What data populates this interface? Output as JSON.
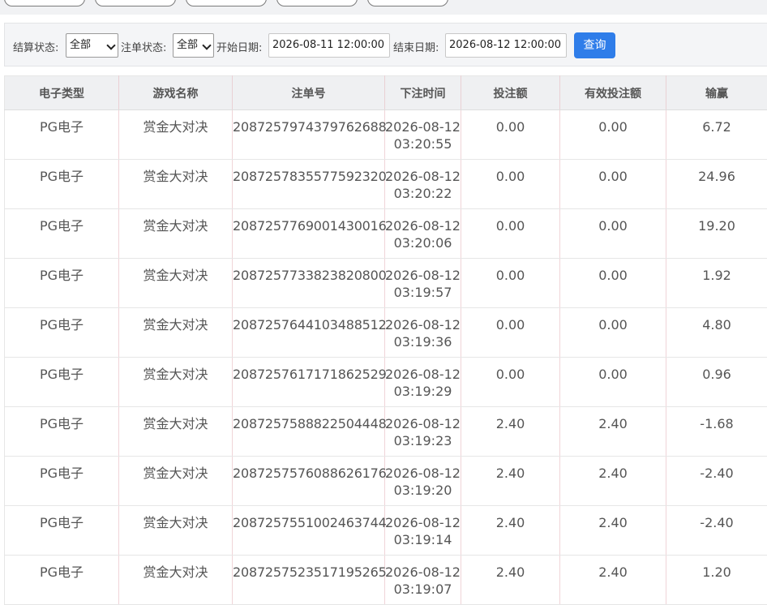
{
  "filters": {
    "settle_status_label": "结算状态:",
    "settle_status_value": "全部",
    "order_status_label": "注单状态:",
    "order_status_value": "全部",
    "start_date_label": "开始日期:",
    "start_date_value": "2026-08-11 12:00:00",
    "end_date_label": "结束日期:",
    "end_date_value": "2026-08-12 12:00:00",
    "query_button": "查询"
  },
  "table": {
    "headers": [
      "电子类型",
      "游戏名称",
      "注单号",
      "下注时间",
      "投注额",
      "有效投注额",
      "输赢"
    ],
    "rows": [
      {
        "type": "PG电子",
        "game": "赏金大对决",
        "order": "2087257974379762688",
        "date": "2026-08-12",
        "time": "03:20:55",
        "bet": "0.00",
        "valid": "0.00",
        "win": "6.72"
      },
      {
        "type": "PG电子",
        "game": "赏金大对决",
        "order": "2087257835577592320",
        "date": "2026-08-12",
        "time": "03:20:22",
        "bet": "0.00",
        "valid": "0.00",
        "win": "24.96"
      },
      {
        "type": "PG电子",
        "game": "赏金大对决",
        "order": "2087257769001430016",
        "date": "2026-08-12",
        "time": "03:20:06",
        "bet": "0.00",
        "valid": "0.00",
        "win": "19.20"
      },
      {
        "type": "PG电子",
        "game": "赏金大对决",
        "order": "2087257733823820800",
        "date": "2026-08-12",
        "time": "03:19:57",
        "bet": "0.00",
        "valid": "0.00",
        "win": "1.92"
      },
      {
        "type": "PG电子",
        "game": "赏金大对决",
        "order": "2087257644103488512",
        "date": "2026-08-12",
        "time": "03:19:36",
        "bet": "0.00",
        "valid": "0.00",
        "win": "4.80"
      },
      {
        "type": "PG电子",
        "game": "赏金大对决",
        "order": "2087257617171862529",
        "date": "2026-08-12",
        "time": "03:19:29",
        "bet": "0.00",
        "valid": "0.00",
        "win": "0.96"
      },
      {
        "type": "PG电子",
        "game": "赏金大对决",
        "order": "2087257588822504448",
        "date": "2026-08-12",
        "time": "03:19:23",
        "bet": "2.40",
        "valid": "2.40",
        "win": "-1.68"
      },
      {
        "type": "PG电子",
        "game": "赏金大对决",
        "order": "2087257576088626176",
        "date": "2026-08-12",
        "time": "03:19:20",
        "bet": "2.40",
        "valid": "2.40",
        "win": "-2.40"
      },
      {
        "type": "PG电子",
        "game": "赏金大对决",
        "order": "2087257551002463744",
        "date": "2026-08-12",
        "time": "03:19:14",
        "bet": "2.40",
        "valid": "2.40",
        "win": "-2.40"
      },
      {
        "type": "PG电子",
        "game": "赏金大对决",
        "order": "2087257523517195265",
        "date": "2026-08-12",
        "time": "03:19:07",
        "bet": "2.40",
        "valid": "2.40",
        "win": "1.20"
      }
    ]
  },
  "colors": {
    "accent": "#2f7de9",
    "header_bg": "#eff0f2",
    "filter_bg": "#f4f5f7"
  }
}
